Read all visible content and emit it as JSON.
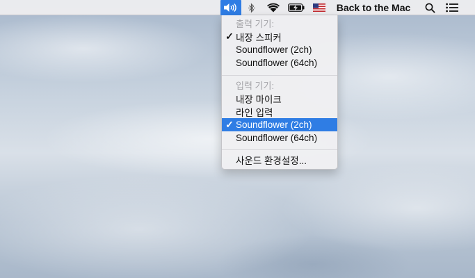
{
  "menubar": {
    "title": "Back to the Mac",
    "icons": [
      "volume-icon",
      "bluetooth-icon",
      "wifi-icon",
      "battery-charging-icon",
      "us-flag-icon",
      "search-icon",
      "list-icon"
    ],
    "accent": "#2e7ce4"
  },
  "menu": {
    "output_header": "출력 기기:",
    "output_items": [
      {
        "label": "내장 스피커",
        "checked": true
      },
      {
        "label": "Soundflower (2ch)",
        "checked": false
      },
      {
        "label": "Soundflower (64ch)",
        "checked": false
      }
    ],
    "input_header": "입력 기기:",
    "input_items": [
      {
        "label": "내장 마이크",
        "checked": false
      },
      {
        "label": "라인 입력",
        "checked": false
      },
      {
        "label": "Soundflower (2ch)",
        "checked": true,
        "highlighted": true
      },
      {
        "label": "Soundflower (64ch)",
        "checked": false
      }
    ],
    "preferences": "사운드 환경설정...",
    "check_mark": "✓",
    "highlight_color": "#2f7de4"
  }
}
